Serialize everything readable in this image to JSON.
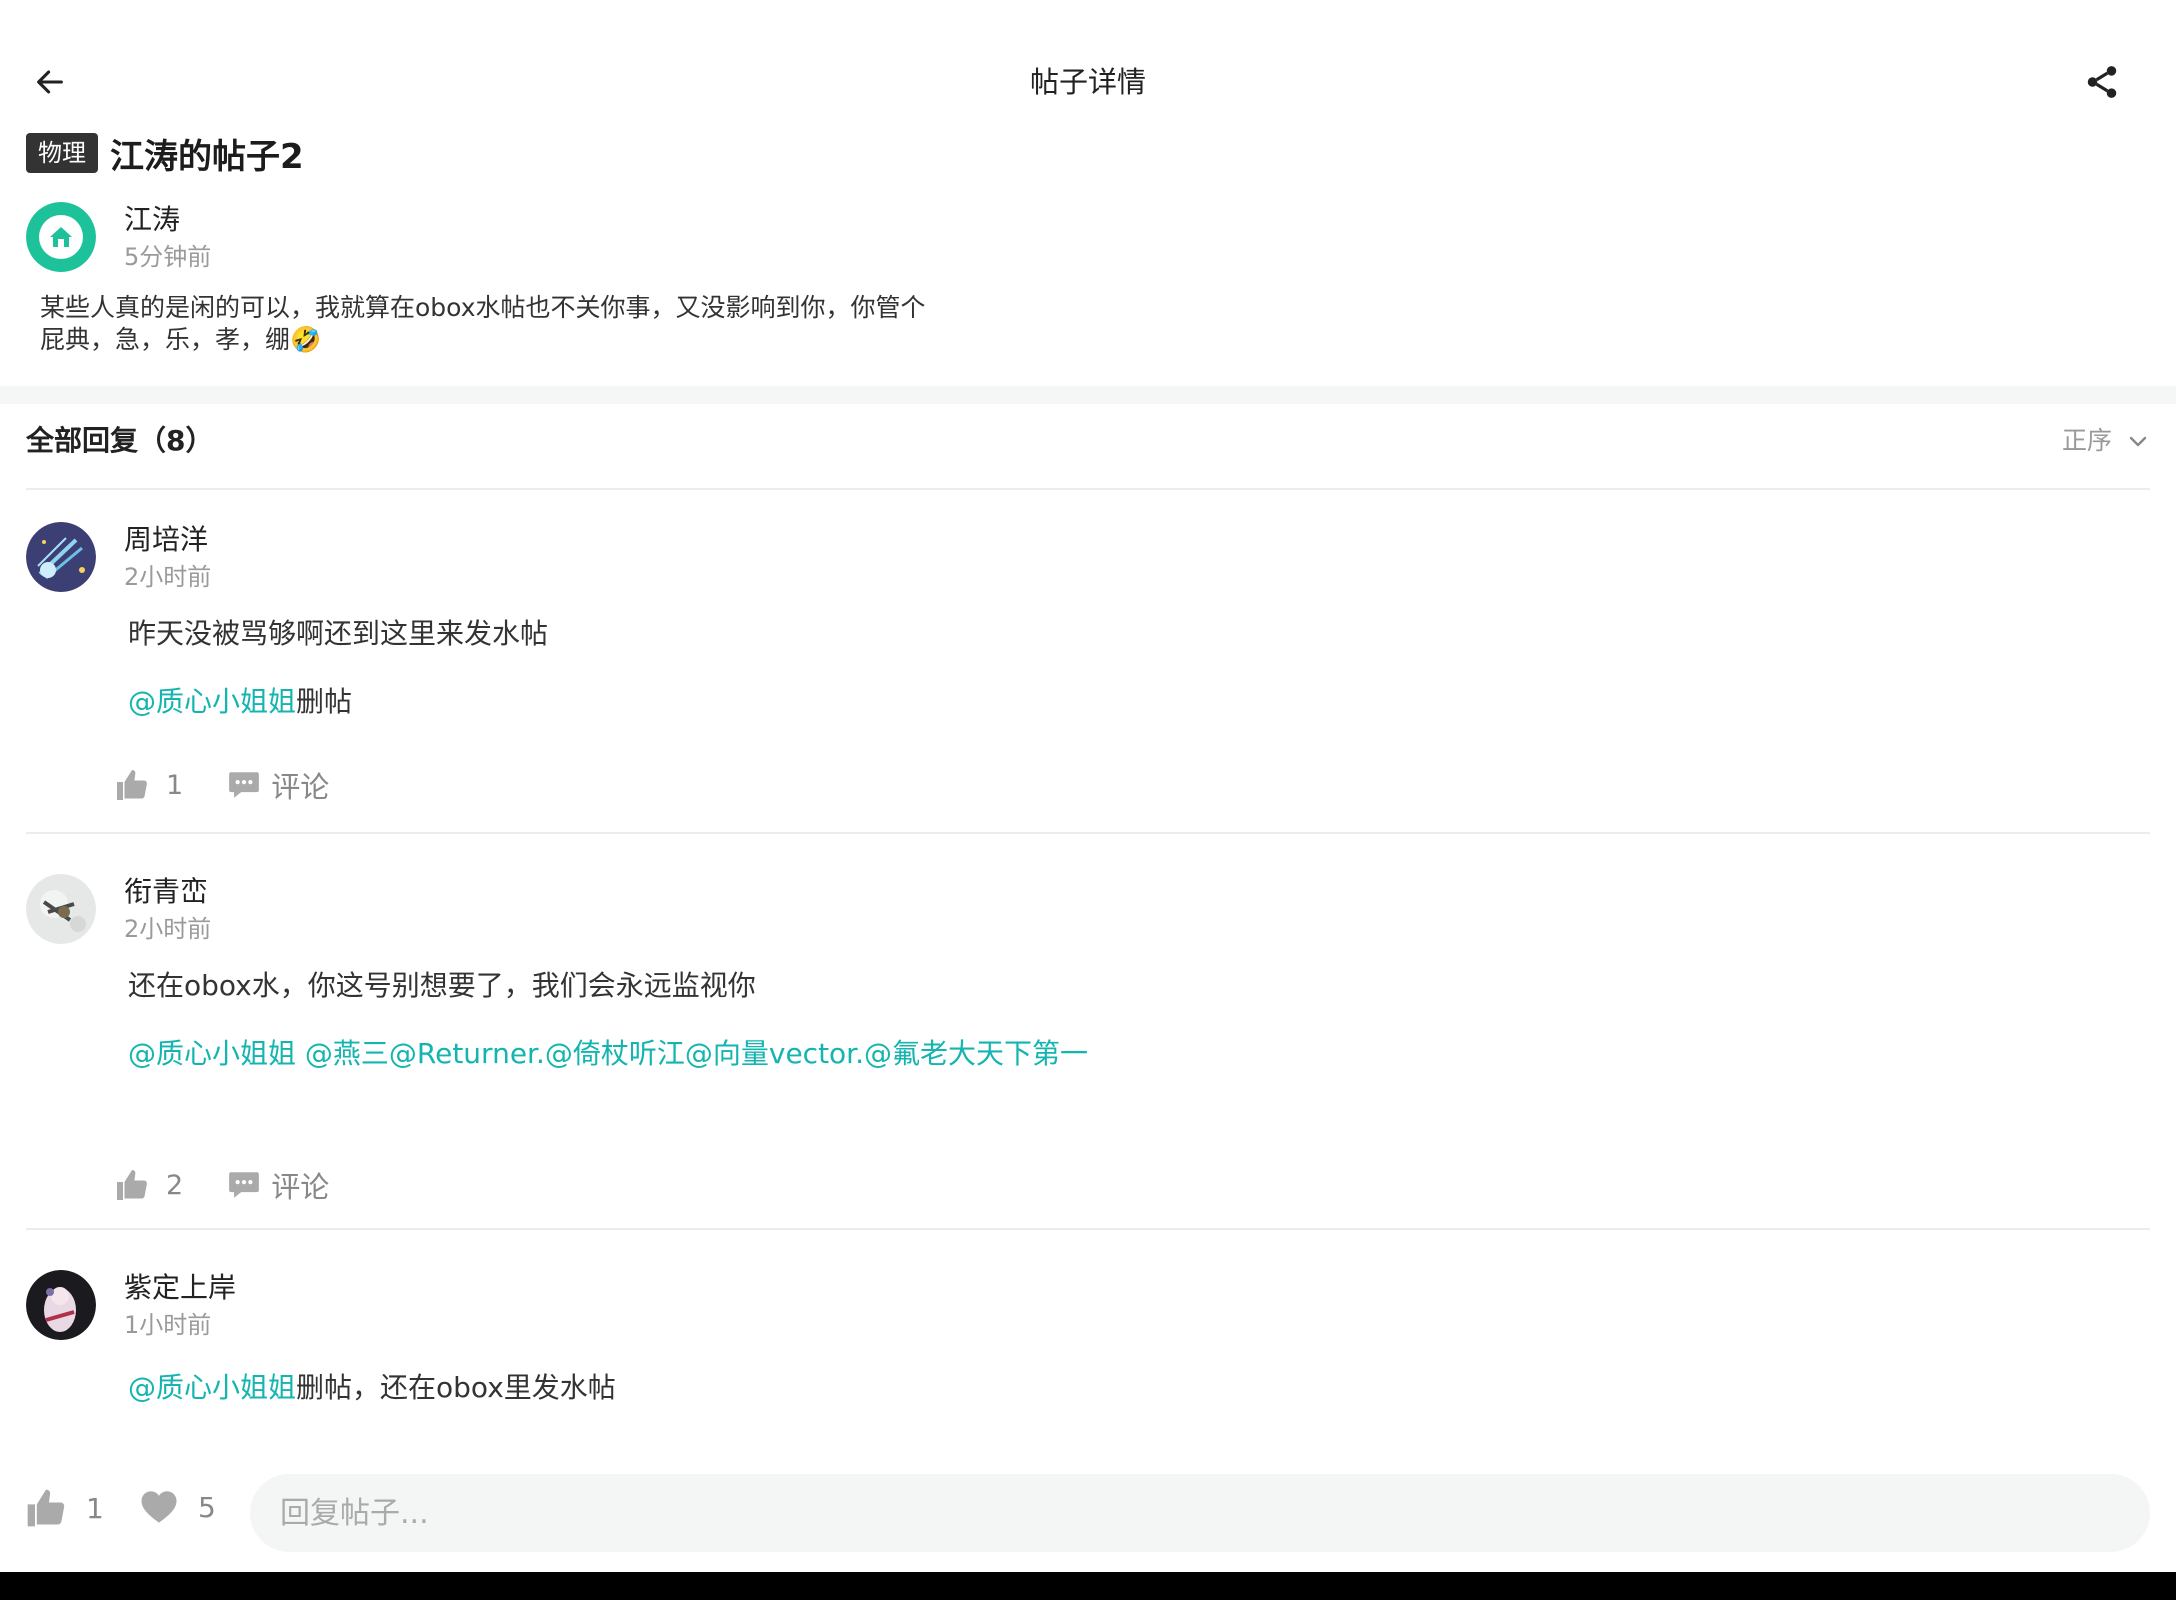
{
  "nav": {
    "title": "帖子详情"
  },
  "post": {
    "tag": "物理",
    "title": "江涛的帖子2",
    "author": "江涛",
    "time": "5分钟前",
    "body": "某些人真的是闲的可以，我就算在obox水帖也不关你事，又没影响到你，你管个屁典，急，乐，孝，绷🤣"
  },
  "replies_header": {
    "title": "全部回复（8）",
    "sort_label": "正序"
  },
  "replies": [
    {
      "author": "周培洋",
      "time": "2小时前",
      "text": "昨天没被骂够啊还到这里来发水帖",
      "mention": "@质心小姐姐",
      "mention_suffix": "删帖",
      "likes": "1",
      "comment_label": "评论"
    },
    {
      "author": "衔青峦",
      "time": "2小时前",
      "text": "还在obox水，你这号别想要了，我们会永远监视你",
      "mention": "@质心小姐姐 @燕三@Returner.@倚杖听江@向量vector.@氟老大天下第一",
      "likes": "2",
      "comment_label": "评论"
    },
    {
      "author": "紫定上岸",
      "time": "1小时前",
      "mention": "@质心小姐姐",
      "mention_suffix": "删帖，还在obox里发水帖"
    }
  ],
  "bottom": {
    "likes": "1",
    "favorites": "5",
    "input_placeholder": "回复帖子..."
  },
  "colors": {
    "accent": "#14b5b0",
    "teal_avatar": "#1dc29b"
  },
  "icons": [
    "back-arrow-icon",
    "share-icon",
    "chevron-down-icon",
    "thumb-up-icon",
    "comment-icon",
    "heart-icon",
    "home-icon"
  ]
}
